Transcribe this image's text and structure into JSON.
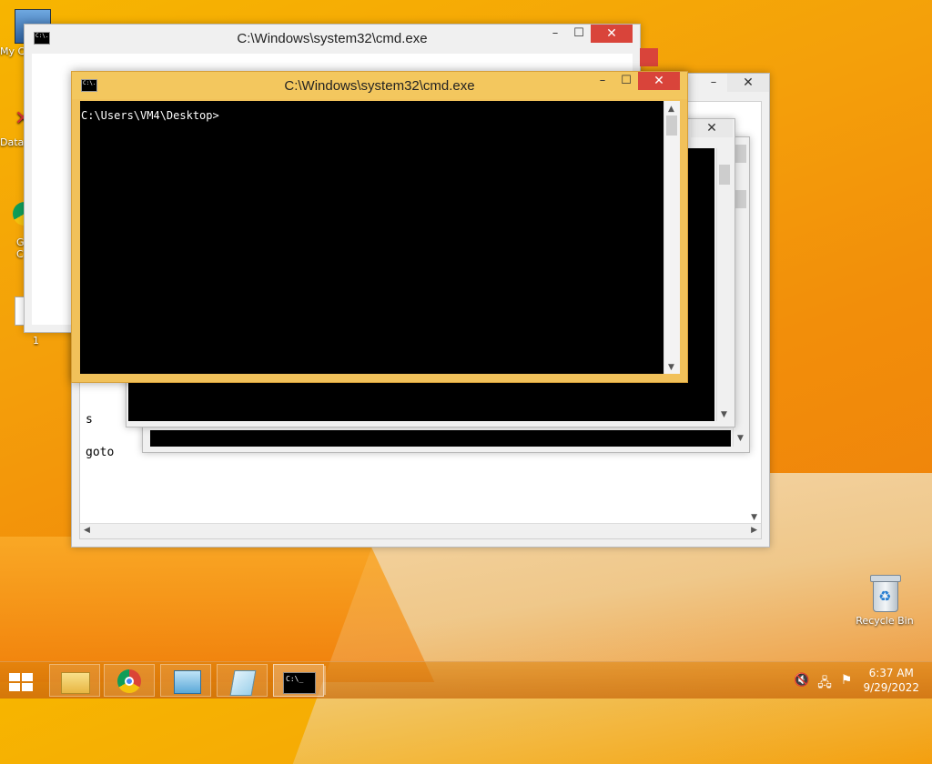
{
  "desktop": {
    "left_labels": [
      "My C",
      "Data",
      "G",
      "C",
      "1"
    ],
    "recycle_bin_label": "Recycle Bin"
  },
  "windows": {
    "front": {
      "title": "C:\\Windows\\system32\\cmd.exe",
      "prompt": "C:\\Users\\VM4\\Desktop>"
    },
    "back_top": {
      "title": "C:\\Windows\\system32\\cmd.exe"
    },
    "back_code": {
      "lines": [
        "s",
        "goto"
      ]
    }
  },
  "controls": {
    "minimize": "–",
    "maximize": "☐",
    "close": "✕"
  },
  "taskbar": {
    "items": [
      "start-button",
      "file-explorer",
      "chrome",
      "control-panel",
      "notepad",
      "cmd"
    ],
    "clock_time": "6:37 AM",
    "clock_date": "9/29/2022"
  },
  "colors": {
    "accent": "#f3c75e",
    "close": "#d9443a"
  }
}
